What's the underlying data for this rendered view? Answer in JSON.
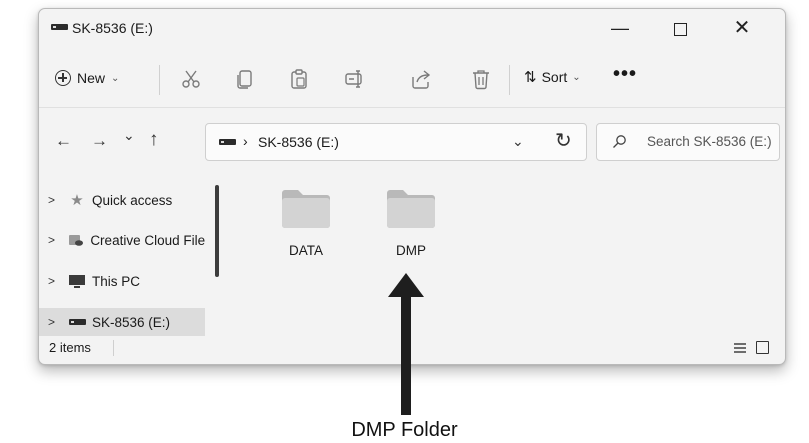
{
  "window": {
    "title": "SK-8536 (E:)",
    "controls": {
      "minimize": "—",
      "close": "✕"
    }
  },
  "toolbar": {
    "new_label": "New",
    "sort_label": "Sort",
    "more_label": "•••",
    "icons": [
      "cut-icon",
      "copy-icon",
      "paste-icon",
      "rename-icon",
      "share-icon",
      "delete-icon"
    ]
  },
  "navigation": {
    "back": "←",
    "forward": "→",
    "recent": "⌄",
    "up": "↑",
    "address_separator": "›",
    "address_path": "SK-8536 (E:)",
    "address_dropdown": "⌄",
    "refresh": "↻",
    "search_placeholder": "Search SK-8536 (E:)"
  },
  "sidebar": {
    "items": [
      {
        "label": "Quick access",
        "icon": "star-icon",
        "selected": false
      },
      {
        "label": "Creative Cloud Files",
        "icon": "cloud-folder-icon",
        "selected": false
      },
      {
        "label": "This PC",
        "icon": "monitor-icon",
        "selected": false
      },
      {
        "label": "SK-8536 (E:)",
        "icon": "drive-icon",
        "selected": true
      }
    ],
    "expand_glyph": ">"
  },
  "content": {
    "folders": [
      {
        "name": "DATA"
      },
      {
        "name": "DMP"
      }
    ]
  },
  "statusbar": {
    "item_count": "2 items"
  },
  "annotation": {
    "caption": "DMP Folder"
  },
  "colors": {
    "window_bg": "#f3f3f3",
    "folder": "#cdcdcd",
    "selected": "#dcdcdc",
    "arrow": "#1e1e1e"
  }
}
